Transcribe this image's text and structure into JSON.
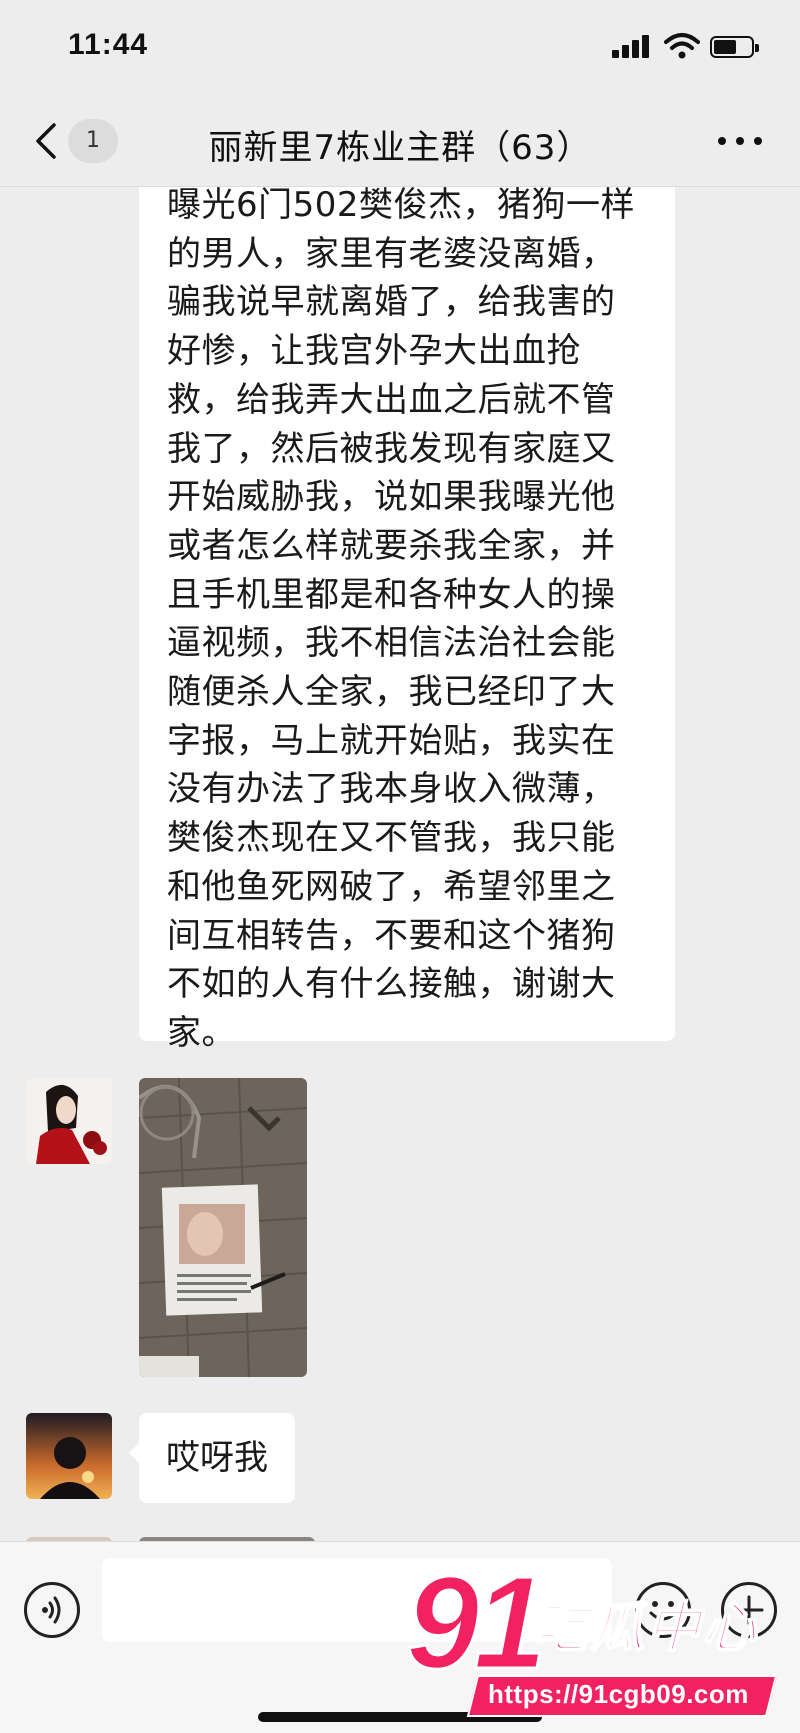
{
  "status_bar": {
    "time": "11:44"
  },
  "nav": {
    "unread_count": "1",
    "title": "丽新里7栋业主群（63）"
  },
  "messages": {
    "long_text": "曝光6门502樊俊杰，猪狗一样的男人，家里有老婆没离婚，骗我说早就离婚了，给我害的好惨，让我宫外孕大出血抢救，给我弄大出血之后就不管我了，然后被我发现有家庭又开始威胁我，说如果我曝光他或者怎么样就要杀我全家，并且手机里都是和各种女人的操逼视频，我不相信法治社会能随便杀人全家，我已经印了大字报，马上就开始贴，我实在没有办法了我本身收入微薄，樊俊杰现在又不管我，我只能和他鱼死网破了，希望邻里之间互相转告，不要和这个猪狗不如的人有什么接触，谢谢大家。",
    "short_text": "哎呀我"
  },
  "input_bar": {
    "placeholder": ""
  },
  "watermark": {
    "number": "91",
    "name": "吃瓜中心",
    "url": "https://91cgb09.com"
  },
  "colors": {
    "background": "#ededed",
    "bubble": "#ffffff",
    "watermark_pink": "#f2215f"
  }
}
